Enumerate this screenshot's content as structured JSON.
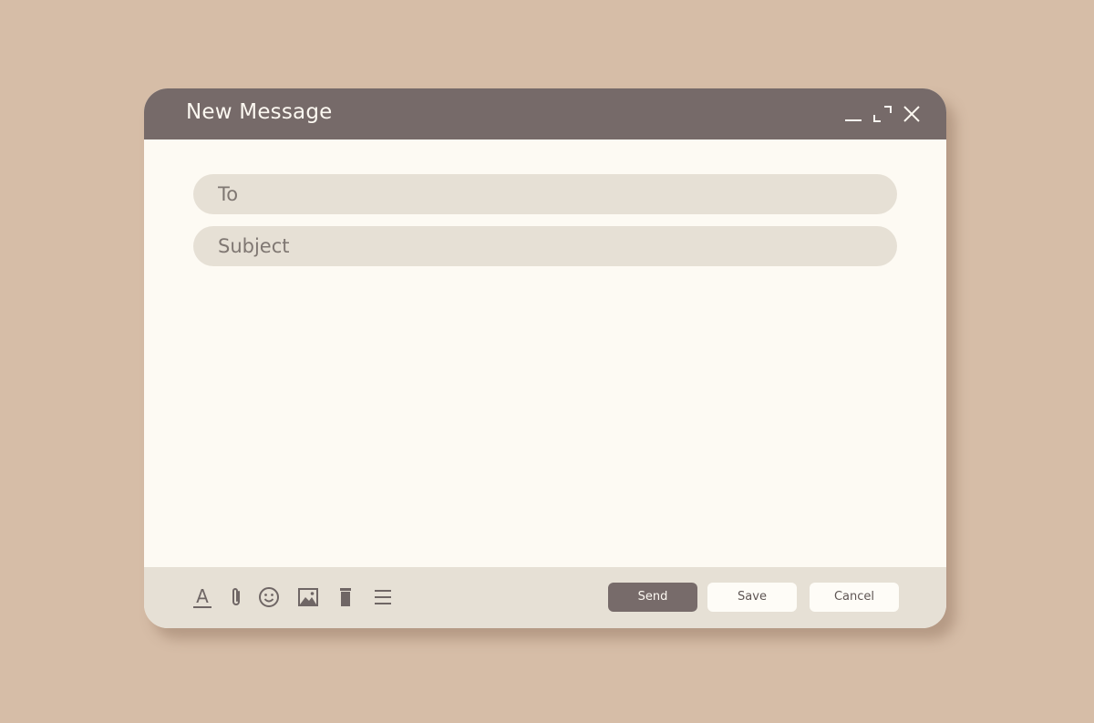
{
  "window": {
    "title": "New Message",
    "controls": [
      {
        "name": "minimize-icon"
      },
      {
        "name": "maximize-icon"
      },
      {
        "name": "close-icon"
      }
    ]
  },
  "form": {
    "to": {
      "placeholder": "To",
      "value": ""
    },
    "subject": {
      "placeholder": "Subject",
      "value": ""
    },
    "body": {
      "value": ""
    }
  },
  "toolbar": {
    "tools": [
      {
        "icon": "text-format-icon"
      },
      {
        "icon": "attachment-icon"
      },
      {
        "icon": "emoji-icon"
      },
      {
        "icon": "image-icon"
      },
      {
        "icon": "trash-icon"
      },
      {
        "icon": "menu-icon"
      }
    ],
    "send_label": "Send",
    "save_label": "Save",
    "cancel_label": "Cancel"
  },
  "colors": {
    "background": "#d6bda7",
    "titlebar": "#766a69",
    "window": "#fdfaf3",
    "field": "#e6e0d5",
    "icon": "#6f6665",
    "send_button": "#776b6a"
  }
}
